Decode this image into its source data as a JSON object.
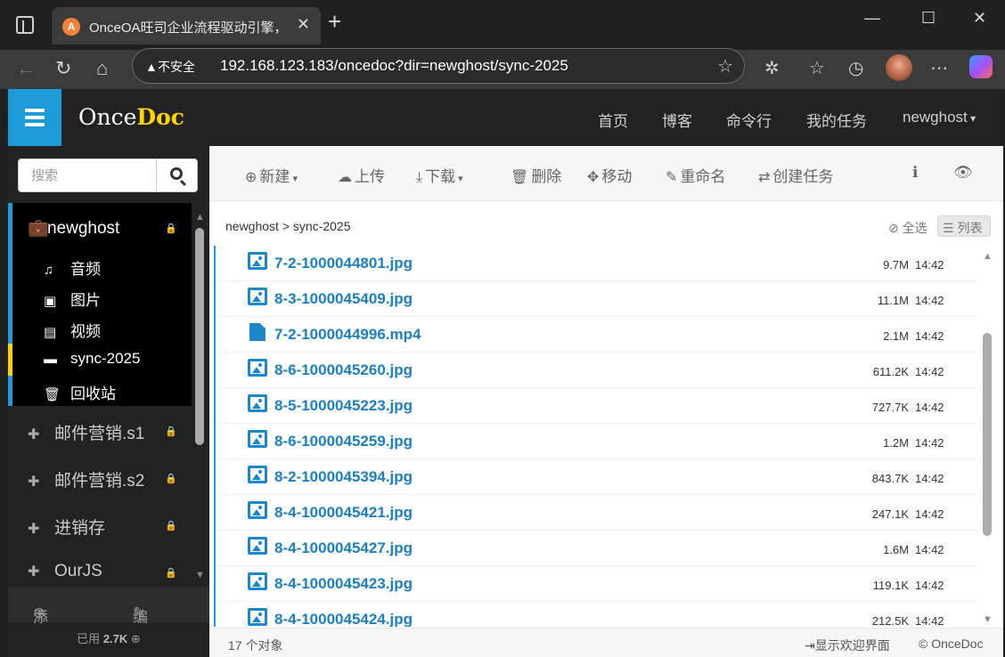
{
  "browser": {
    "tab_title": "OnceOA旺司企业流程驱动引擎，",
    "favicon_letter": "A",
    "security_label": "不安全",
    "url": "192.168.123.183/oncedoc?dir=newghost/sync-2025"
  },
  "header": {
    "logo_plain": "Once",
    "logo_bold": "Doc",
    "nav": [
      "首页",
      "博客",
      "命令行",
      "我的任务"
    ],
    "user": "newghost"
  },
  "sidebar": {
    "search_placeholder": "搜索",
    "root": "newghost",
    "items": [
      {
        "label": "音频",
        "icon": "music-icon"
      },
      {
        "label": "图片",
        "icon": "image-icon"
      },
      {
        "label": "视频",
        "icon": "film-icon"
      },
      {
        "label": "sync-2025",
        "icon": "folder-icon"
      },
      {
        "label": "回收站",
        "icon": "trash-icon"
      }
    ],
    "groups": [
      "邮件营销.s1",
      "邮件营销.s2",
      "进销存",
      "OurJS"
    ],
    "footer_add": "添加",
    "footer_edit": "编辑",
    "usage_prefix": "已用",
    "usage_value": "2.7K"
  },
  "toolbar": {
    "new": "新建",
    "upload": "上传",
    "download": "下载",
    "delete": "删除",
    "move": "移动",
    "rename": "重命名",
    "create_task": "创建任务"
  },
  "breadcrumb": {
    "root": "newghost",
    "sep": ">",
    "current": "sync-2025"
  },
  "select_all": "全选",
  "view_mode": "列表",
  "files": [
    {
      "name": "7-2-1000044801.jpg",
      "type": "image",
      "size": "9.7M",
      "time": "14:42"
    },
    {
      "name": "8-3-1000045409.jpg",
      "type": "image",
      "size": "11.1M",
      "time": "14:42"
    },
    {
      "name": "7-2-1000044996.mp4",
      "type": "video",
      "size": "2.1M",
      "time": "14:42"
    },
    {
      "name": "8-6-1000045260.jpg",
      "type": "image",
      "size": "611.2K",
      "time": "14:42"
    },
    {
      "name": "8-5-1000045223.jpg",
      "type": "image",
      "size": "727.7K",
      "time": "14:42"
    },
    {
      "name": "8-6-1000045259.jpg",
      "type": "image",
      "size": "1.2M",
      "time": "14:42"
    },
    {
      "name": "8-2-1000045394.jpg",
      "type": "image",
      "size": "843.7K",
      "time": "14:42"
    },
    {
      "name": "8-4-1000045421.jpg",
      "type": "image",
      "size": "247.1K",
      "time": "14:42"
    },
    {
      "name": "8-4-1000045427.jpg",
      "type": "image",
      "size": "1.6M",
      "time": "14:42"
    },
    {
      "name": "8-4-1000045423.jpg",
      "type": "image",
      "size": "119.1K",
      "time": "14:42"
    },
    {
      "name": "8-4-1000045424.jpg",
      "type": "image",
      "size": "212.5K",
      "time": "14:42"
    }
  ],
  "status": {
    "count": "17 个对象",
    "welcome": "显示欢迎界面",
    "copyright": "© OnceDoc"
  }
}
